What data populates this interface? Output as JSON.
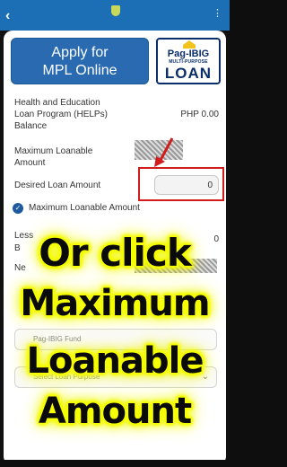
{
  "statusbar": {
    "back_icon": "chevron-left-icon"
  },
  "header": {
    "apply_line1": "Apply for",
    "apply_line2": "MPL Online",
    "logo": {
      "pagibig": "Pag-IBIG",
      "subtitle": "MULTI-PURPOSE",
      "loan": "LOAN"
    }
  },
  "rows": {
    "helps_label_1": "Health and Education",
    "helps_label_2": "Loan Program (HELPs)",
    "helps_label_3": "Balance",
    "helps_value": "PHP 0.00",
    "max_label_1": "Maximum Loanable",
    "max_label_2": "Amount",
    "desired_label": "Desired Loan Amount",
    "desired_value": "0",
    "checkbox_label": "Maximum Loanable Amount",
    "less_partial": "Less",
    "b_partial": "B",
    "net_partial": "Ne",
    "zero_partial": "0"
  },
  "fields": {
    "fund_placeholder": "Pag-IBIG Fund",
    "purpose_placeholder": "Select Loan Purpose"
  },
  "overlay": {
    "line1": "Or click",
    "line2": "Maximum",
    "line3": "Loanable",
    "line4": "Amount"
  },
  "colors": {
    "accent": "#2a6ab1",
    "highlight": "#f6ff00",
    "alert": "#d21c1c"
  }
}
